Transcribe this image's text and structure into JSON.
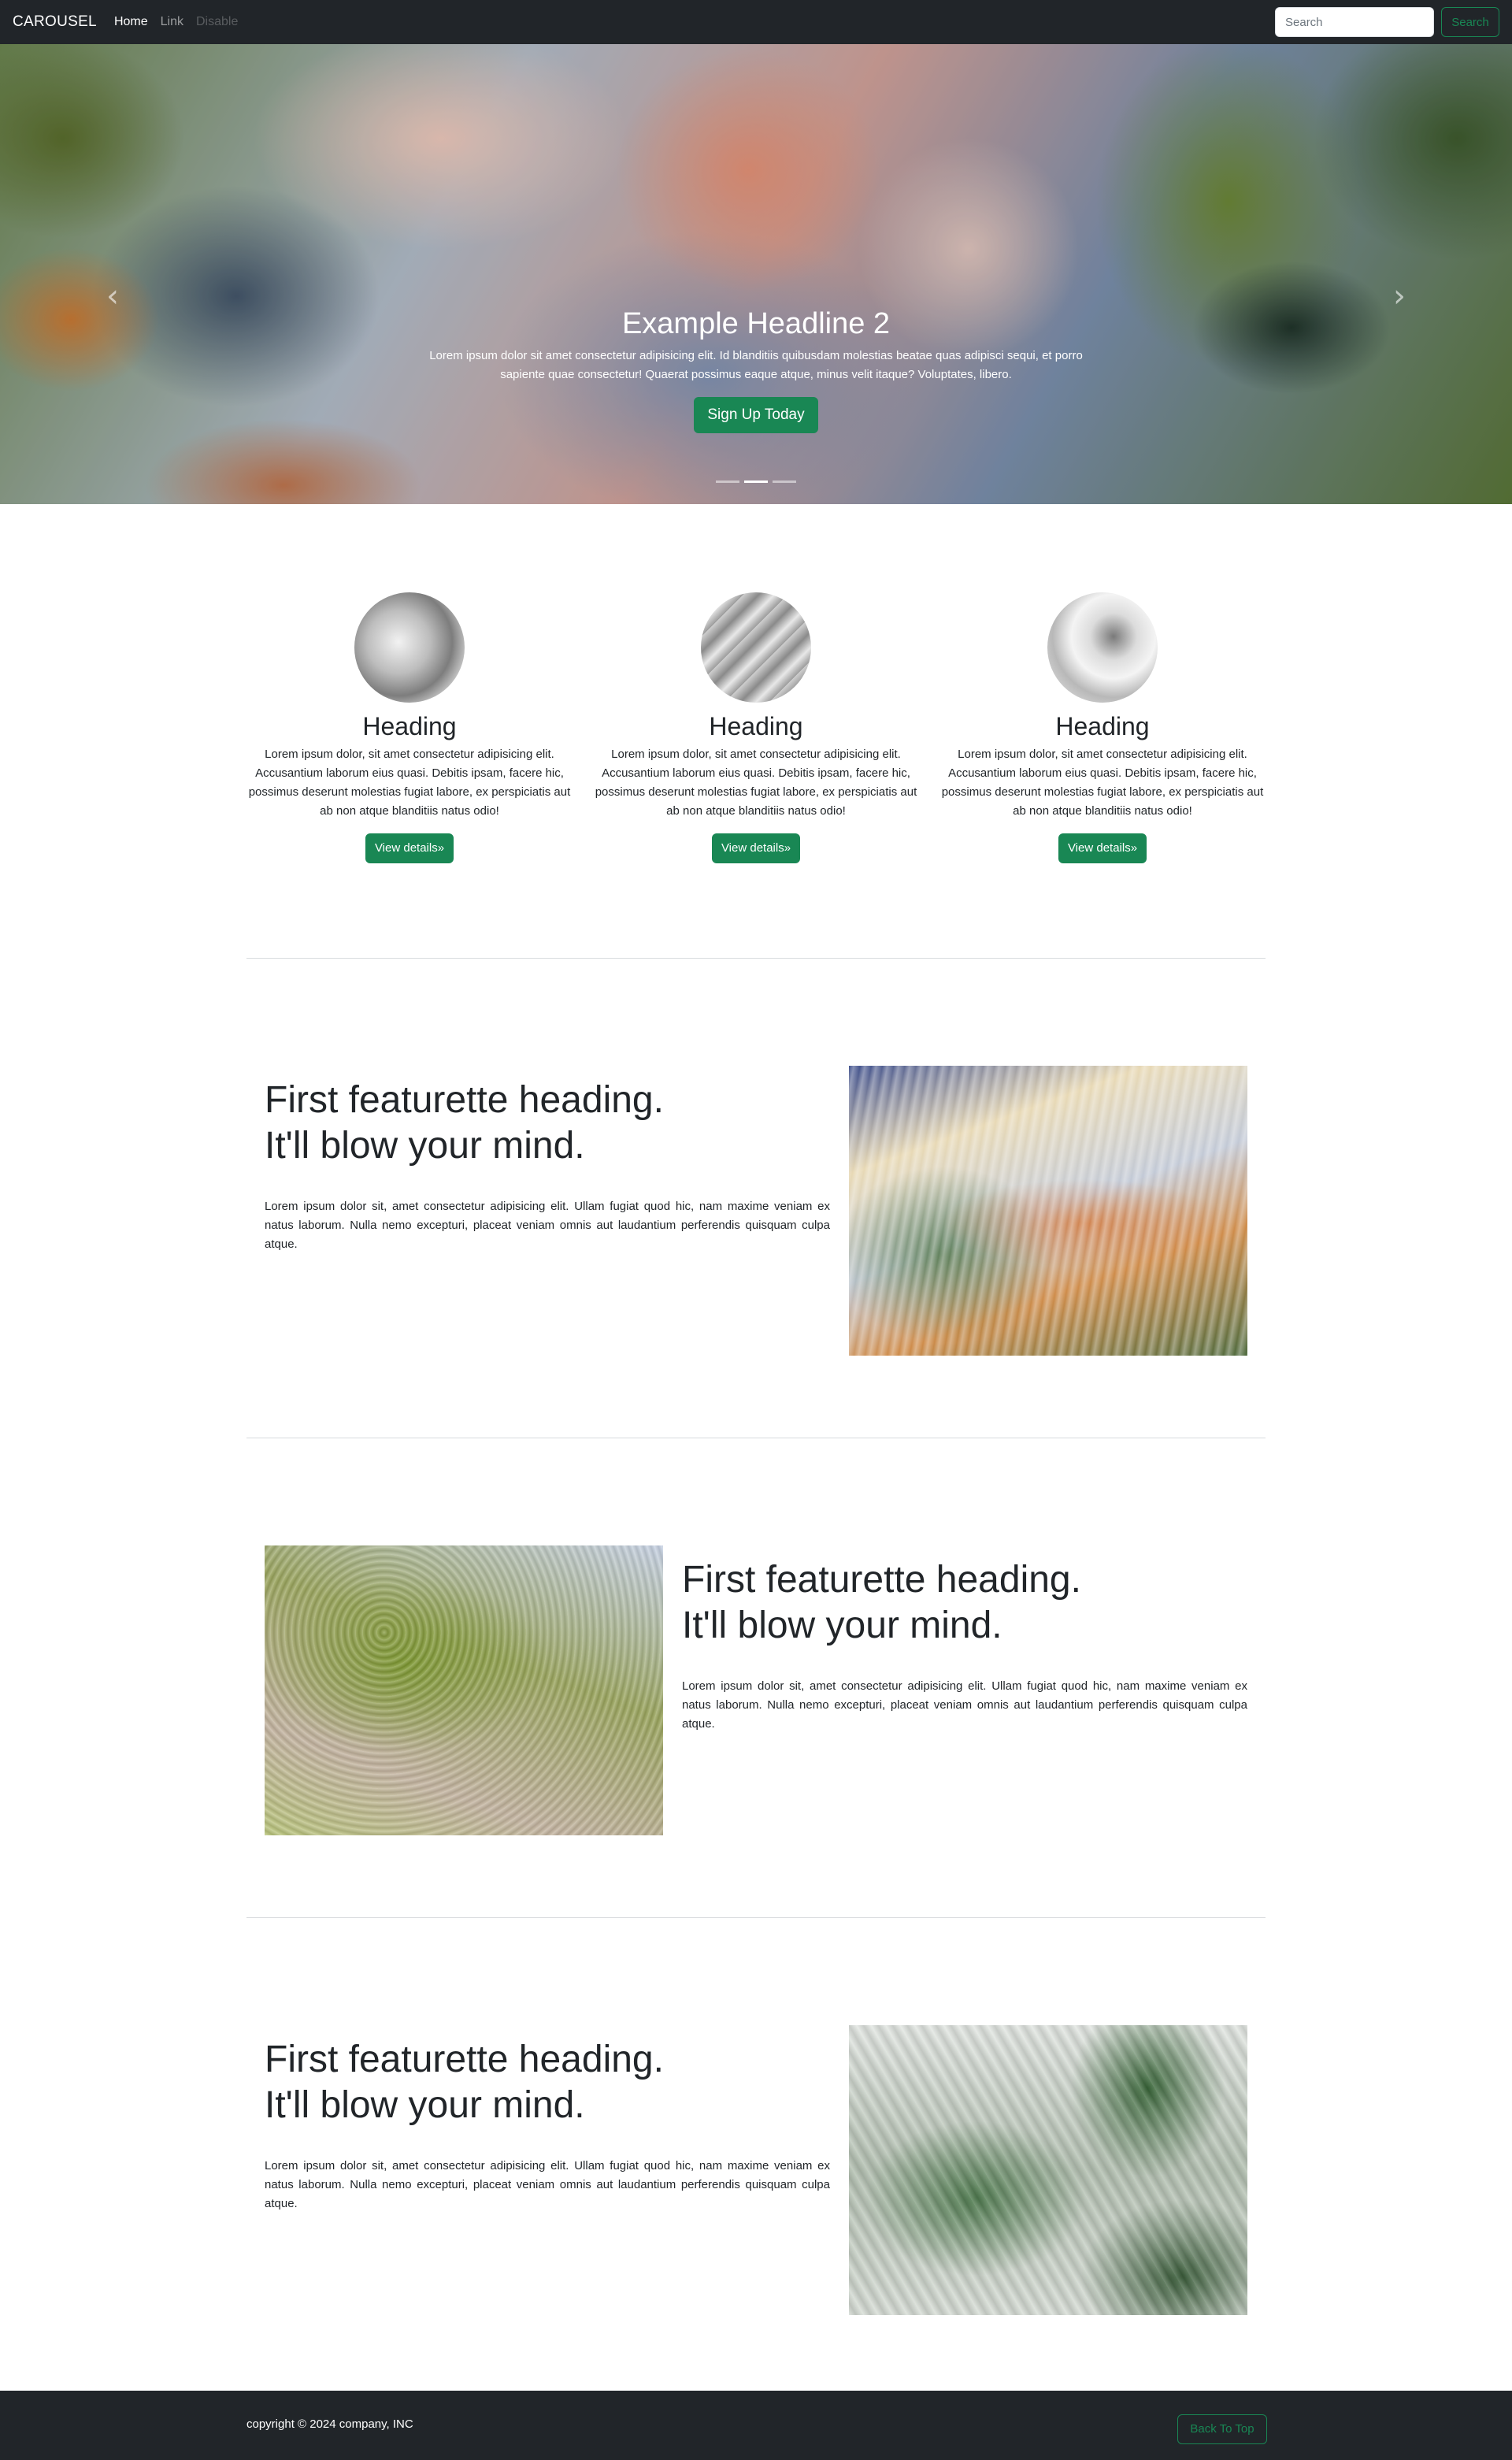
{
  "navbar": {
    "brand": "CAROUSEL",
    "links": [
      {
        "label": "Home",
        "state": "active"
      },
      {
        "label": "Link",
        "state": "normal"
      },
      {
        "label": "Disable",
        "state": "disabled"
      }
    ],
    "search": {
      "placeholder": "Search",
      "value": ""
    },
    "search_button": "Search"
  },
  "carousel": {
    "headline": "Example Headline 2",
    "text": "Lorem ipsum dolor sit amet consectetur adipisicing elit. Id blanditiis quibusdam molestias beatae quas adipisci sequi, et porro sapiente quae consectetur! Quaerat possimus eaque atque, minus velit itaque? Voluptates, libero.",
    "button": "Sign Up Today",
    "prev_icon": "chevron-left-icon",
    "next_icon": "chevron-right-icon",
    "prev_glyph": "‹",
    "next_glyph": "›",
    "slide_count": 3,
    "active_slide": 2
  },
  "columns": [
    {
      "heading": "Heading",
      "text": "Lorem ipsum dolor, sit amet consectetur adipisicing elit. Accusantium laborum eius quasi. Debitis ipsam, facere hic, possimus deserunt molestias fugiat labore, ex perspiciatis aut ab non atque blanditiis natus odio!",
      "button": "View details»"
    },
    {
      "heading": "Heading",
      "text": "Lorem ipsum dolor, sit amet consectetur adipisicing elit. Accusantium laborum eius quasi. Debitis ipsam, facere hic, possimus deserunt molestias fugiat labore, ex perspiciatis aut ab non atque blanditiis natus odio!",
      "button": "View details»"
    },
    {
      "heading": "Heading",
      "text": "Lorem ipsum dolor, sit amet consectetur adipisicing elit. Accusantium laborum eius quasi. Debitis ipsam, facere hic, possimus deserunt molestias fugiat labore, ex perspiciatis aut ab non atque blanditiis natus odio!",
      "button": "View details»"
    }
  ],
  "featurettes": [
    {
      "heading_line1": "First featurette heading.",
      "heading_line2": "It'll blow your mind.",
      "text": "Lorem ipsum dolor sit, amet consectetur adipisicing elit. Ullam fugiat quod hic, nam maxime veniam ex natus laborum. Nulla nemo excepturi, placeat veniam omnis aut laudantium perferendis quisquam culpa atque."
    },
    {
      "heading_line1": "First featurette heading.",
      "heading_line2": "It'll blow your mind.",
      "text": "Lorem ipsum dolor sit, amet consectetur adipisicing elit. Ullam fugiat quod hic, nam maxime veniam ex natus laborum. Nulla nemo excepturi, placeat veniam omnis aut laudantium perferendis quisquam culpa atque."
    },
    {
      "heading_line1": "First featurette heading.",
      "heading_line2": "It'll blow your mind.",
      "text": "Lorem ipsum dolor sit, amet consectetur adipisicing elit. Ullam fugiat quod hic, nam maxime veniam ex natus laborum. Nulla nemo excepturi, placeat veniam omnis aut laudantium perferendis quisquam culpa atque."
    }
  ],
  "footer": {
    "copyright": "copyright © 2024 company, INC",
    "back_to_top": "Back To Top"
  },
  "colors": {
    "navbar_bg": "#212529",
    "accent_green": "#198754",
    "divider": "#d8dbde"
  }
}
